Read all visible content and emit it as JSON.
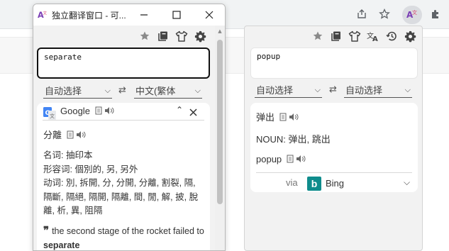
{
  "browser": {
    "toolbar_icons": [
      "share-icon",
      "star-icon",
      "extension-translate-icon",
      "puzzle-icon"
    ]
  },
  "popup": {
    "toolbar_icons": [
      "star-icon",
      "collection-icon",
      "tshirt-icon",
      "translate-icon",
      "history-icon",
      "gear-icon"
    ],
    "input_text": "popup",
    "source_lang": "自动选择",
    "target_lang": "自动选择",
    "result": {
      "translation": "弹出",
      "definition": "NOUN: 弹出, 跳出",
      "source_word": "popup",
      "via_label": "via",
      "engine": "Bing",
      "engine_logo_letter": "b"
    }
  },
  "window": {
    "title": "独立翻译窗口 - 可...",
    "toolbar_icons": [
      "star-icon",
      "collection-icon",
      "tshirt-icon",
      "gear-icon"
    ],
    "input_text": "separate",
    "source_lang": "自动选择",
    "target_lang": "中文(繁体",
    "result": {
      "engine": "Google",
      "translation": "分離",
      "def_noun": "名词: 抽印本",
      "def_adj": "形容词: 個別的, 另, 另外",
      "def_verb": "动词: 別, 拆開, 分, 分開, 分離, 割裂, 隔, 隔斷, 隔絕, 隔開, 隔離, 間, 閒, 解, 披, 脫離, 析, 異, 阻隔",
      "example_plain": "the second stage of the rocket failed to ",
      "example_bold": "separate"
    }
  },
  "colors": {
    "bing_teal": "#0f8c8c",
    "google_blue": "#4285f4"
  }
}
